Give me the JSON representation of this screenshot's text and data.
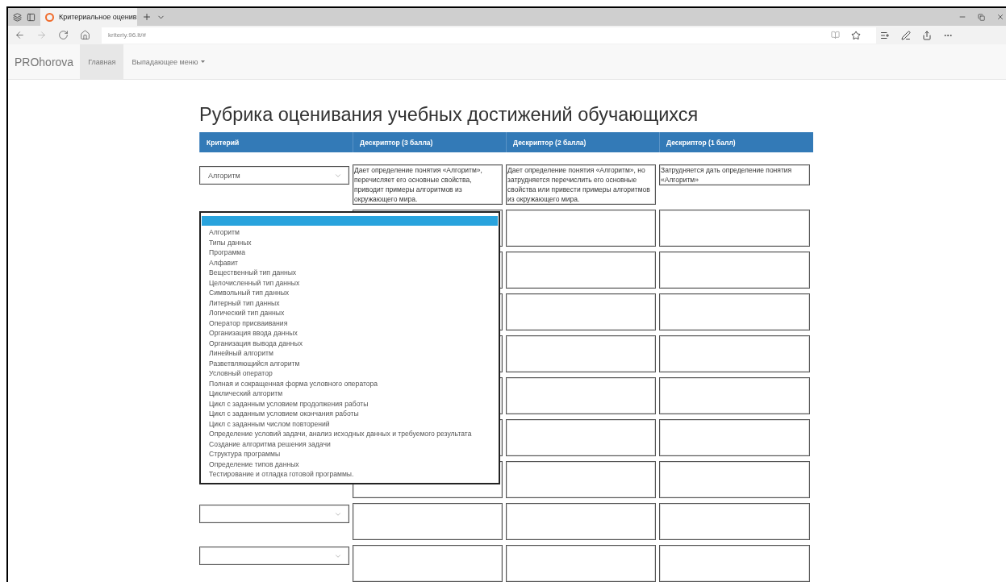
{
  "browser": {
    "tabs": [
      {
        "title": "Критериальное оценив",
        "selected": true
      }
    ],
    "url": "kriteriy.96.lt/#"
  },
  "navbar": {
    "brand": "PROhorova",
    "items": [
      {
        "label": "Главная",
        "selected": true,
        "kind": "link"
      },
      {
        "label": "Выпадающее меню",
        "selected": false,
        "kind": "dropdown"
      }
    ]
  },
  "title": "Рубрика оценивания учебных достижений обучающихся",
  "table": {
    "columns": [
      "Критерий",
      "Дескриптор (3 балла)",
      "Дескриптор (2 балла)",
      "Дескриптор (1 балл)"
    ],
    "rows": [
      {
        "criterion": "Алгоритм",
        "open": false,
        "descriptors": [
          "Дает определение понятия «Алгоритм», перечисляет его основные свойства, приводит примеры алгоритмов из окружающего мира.",
          "Дает определение понятия «Алгоритм», но затрудняется перечислить его основные свойства или привести примеры алгоритмов из окружающего мира.",
          "Затрудняется дать определение понятия «Алгоритм»"
        ]
      },
      {
        "open": true
      },
      {
        "open": false
      },
      {
        "open": false
      },
      {
        "open": false
      },
      {
        "open": false
      },
      {
        "open": false
      },
      {
        "open": false
      },
      {
        "open": false
      },
      {
        "open": false
      }
    ]
  },
  "dropdown": {
    "blank_selected": true,
    "options": [
      {
        "label": "Алгоритм",
        "selected": false
      },
      {
        "label": "Типы данных",
        "selected": false
      },
      {
        "label": "Программа",
        "selected": false
      },
      {
        "label": "Алфавит",
        "selected": false
      },
      {
        "label": "Вещественный тип данных",
        "selected": false
      },
      {
        "label": "Целочисленный тип данных",
        "selected": false
      },
      {
        "label": "Символьный тип данных",
        "selected": false
      },
      {
        "label": "Литерный тип данных",
        "selected": false
      },
      {
        "label": "Логический тип данных",
        "selected": false
      },
      {
        "label": "Оператор присваивания",
        "selected": false
      },
      {
        "label": "Организация ввода данных",
        "selected": false
      },
      {
        "label": "Организация вывода данных",
        "selected": false
      },
      {
        "label": "Линейный алгоритм",
        "selected": false
      },
      {
        "label": "Разветвляющийся алгоритм",
        "selected": false
      },
      {
        "label": "Условный оператор",
        "selected": false
      },
      {
        "label": "Полная и сокращенная форма условного оператора",
        "selected": false
      },
      {
        "label": "Циклический алгоритм",
        "selected": false
      },
      {
        "label": "Цикл с заданным условием продолжения работы",
        "selected": false
      },
      {
        "label": "Цикл с заданным условием окончания работы",
        "selected": false
      },
      {
        "label": "Цикл с заданным числом повторений",
        "selected": false
      },
      {
        "label": "Определение условий задачи, анализ исходных данных и требуемого результата",
        "selected": false
      },
      {
        "label": "Создание алгоритма решения задачи",
        "selected": false
      },
      {
        "label": "Структура программы",
        "selected": false
      },
      {
        "label": "Определение типов данных",
        "selected": false
      },
      {
        "label": "Тестирование и отладка готовой программы.",
        "selected": false
      }
    ]
  }
}
